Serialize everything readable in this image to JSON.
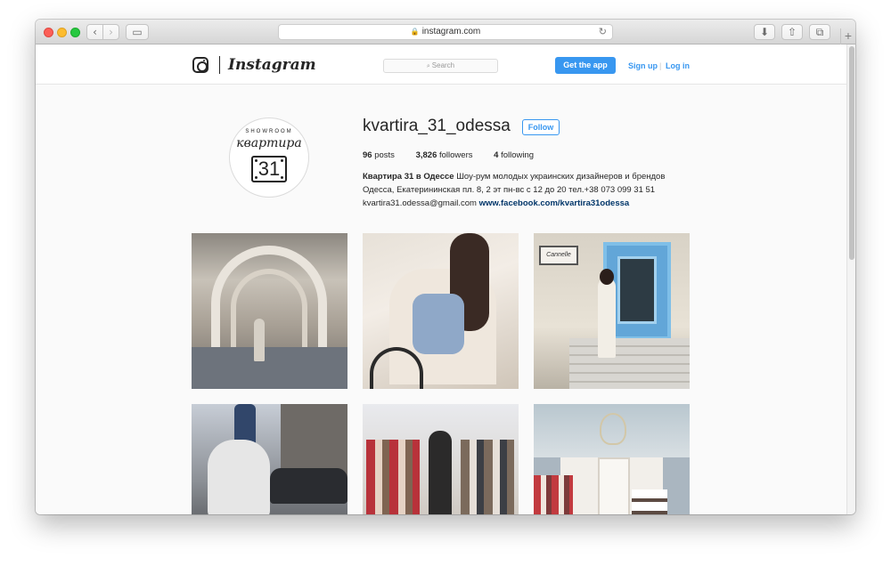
{
  "browser": {
    "url": "instagram.com",
    "nav_back_icon": "‹",
    "nav_forward_icon": "›",
    "sidebar_icon": "▭",
    "reload_icon": "↻",
    "lock_icon": "🔒",
    "download_icon": "⬇",
    "share_icon": "⇧",
    "tabs_icon": "⧉",
    "new_tab_icon": "+"
  },
  "ig_nav": {
    "wordmark": "Instagram",
    "search_placeholder": "Search",
    "search_icon": "⌕",
    "get_app_label": "Get the app",
    "signup_label": "Sign up",
    "separator": "|",
    "login_label": "Log in",
    "accent_color": "#3897f0"
  },
  "profile": {
    "avatar": {
      "top_text": "SHOWROOM",
      "name_text": "квартира",
      "plate_number": "31"
    },
    "username": "kvartira_31_odessa",
    "follow_label": "Follow",
    "stats": {
      "posts_count": "96",
      "posts_label": "posts",
      "followers_count": "3,826",
      "followers_label": "followers",
      "following_count": "4",
      "following_label": "following"
    },
    "bio": {
      "name": "Квартира 31 в Одессе",
      "line1_rest": "Шоу-рум молодых украинских дизайнеров и брендов",
      "line2": "Одесса, Екатерининская пл. 8, 2 эт пн-вс с 12 до 20 тел.+38 073 099 31 51",
      "email": "kvartira31.odessa@gmail.com",
      "link": "www.facebook.com/kvartira31odessa"
    }
  },
  "posts": {
    "tile3_sign": "Cannelle"
  }
}
